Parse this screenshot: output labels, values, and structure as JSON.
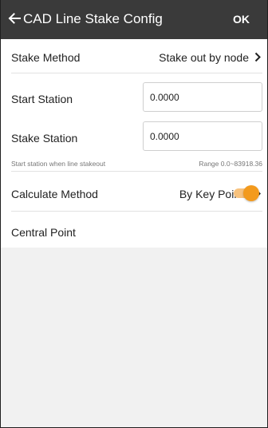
{
  "header": {
    "title": "CAD Line Stake Config",
    "ok_label": "OK"
  },
  "stake_method": {
    "label": "Stake Method",
    "value": "Stake out by node"
  },
  "start_station": {
    "label": "Start Station",
    "value": "0.0000"
  },
  "stake_station": {
    "label": "Stake Station",
    "value": "0.0000"
  },
  "hint": {
    "left": "Start station when line stakeout",
    "right": "Range 0.0~83918.36"
  },
  "calculate_method": {
    "label": "Calculate Method",
    "value": "By Key Points"
  },
  "central_point": {
    "label": "Central Point",
    "enabled": true
  },
  "colors": {
    "header_bg": "#3a3a3a",
    "accent": "#f39a1d",
    "accent_track": "#f7c27e",
    "empty_bg": "#f1f1f1"
  },
  "icons": {
    "back": "arrow-left-icon",
    "chevron": "chevron-right-icon"
  }
}
